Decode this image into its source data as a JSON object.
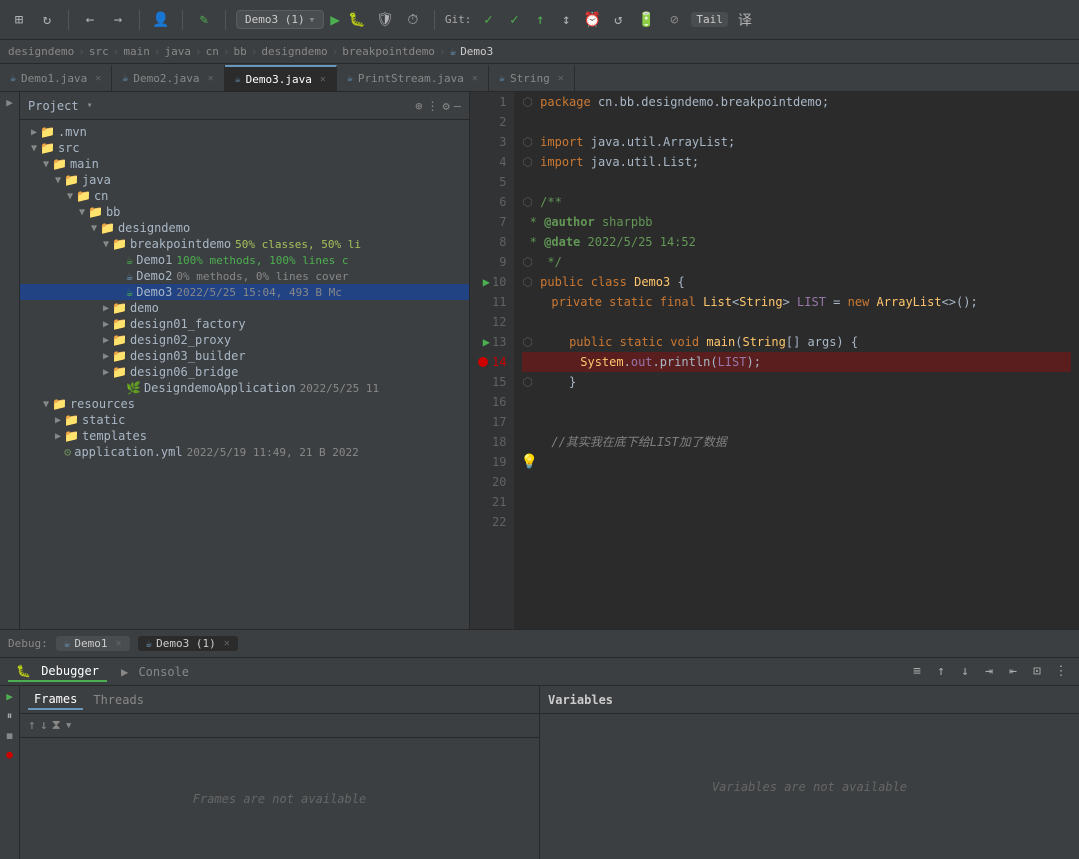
{
  "toolbar": {
    "run_config": "Demo3 (1)",
    "git_label": "Git:",
    "tail_label": "Tail"
  },
  "breadcrumb": {
    "parts": [
      "designdemo",
      "src",
      "main",
      "java",
      "cn",
      "bb",
      "designdemo",
      "breakpointdemo",
      "Demo3"
    ]
  },
  "editor_tabs": [
    {
      "label": "Demo1.java",
      "active": false,
      "icon": "☕"
    },
    {
      "label": "Demo2.java",
      "active": false,
      "icon": "☕"
    },
    {
      "label": "Demo3.java",
      "active": true,
      "icon": "☕"
    },
    {
      "label": "PrintStream.java",
      "active": false,
      "icon": "☕"
    },
    {
      "label": "String",
      "active": false,
      "icon": "☕"
    }
  ],
  "project": {
    "title": "Project",
    "tree": [
      {
        "indent": 0,
        "type": "folder",
        "open": true,
        "label": ".mvn",
        "meta": ""
      },
      {
        "indent": 0,
        "type": "folder",
        "open": true,
        "label": "src",
        "meta": ""
      },
      {
        "indent": 1,
        "type": "folder",
        "open": true,
        "label": "main",
        "meta": ""
      },
      {
        "indent": 2,
        "type": "folder",
        "open": true,
        "label": "java",
        "meta": ""
      },
      {
        "indent": 3,
        "type": "folder",
        "open": true,
        "label": "cn",
        "meta": ""
      },
      {
        "indent": 4,
        "type": "folder",
        "open": true,
        "label": "bb",
        "meta": ""
      },
      {
        "indent": 5,
        "type": "folder",
        "open": true,
        "label": "designdemo",
        "meta": ""
      },
      {
        "indent": 6,
        "type": "folder",
        "open": true,
        "label": "breakpointdemo",
        "meta": "50% classes, 50% li"
      },
      {
        "indent": 7,
        "type": "file-java-green",
        "label": "Demo1",
        "meta": "100% methods, 100% lines c"
      },
      {
        "indent": 7,
        "type": "file-java",
        "label": "Demo2",
        "meta": "0% methods, 0% lines cover"
      },
      {
        "indent": 7,
        "type": "file-java-active",
        "label": "Demo3",
        "meta": "2022/5/25 15:04, 493 B Mc",
        "selected": true
      },
      {
        "indent": 6,
        "type": "folder",
        "open": false,
        "label": "demo",
        "meta": ""
      },
      {
        "indent": 6,
        "type": "folder",
        "open": false,
        "label": "design01_factory",
        "meta": ""
      },
      {
        "indent": 6,
        "type": "folder",
        "open": false,
        "label": "design02_proxy",
        "meta": ""
      },
      {
        "indent": 6,
        "type": "folder",
        "open": false,
        "label": "design03_builder",
        "meta": ""
      },
      {
        "indent": 6,
        "type": "folder",
        "open": false,
        "label": "design06_bridge",
        "meta": ""
      },
      {
        "indent": 6,
        "type": "file-spring",
        "label": "DesigndemoApplication",
        "meta": "2022/5/25 11"
      },
      {
        "indent": 1,
        "type": "folder",
        "open": true,
        "label": "resources",
        "meta": ""
      },
      {
        "indent": 2,
        "type": "folder",
        "open": false,
        "label": "static",
        "meta": ""
      },
      {
        "indent": 2,
        "type": "folder",
        "open": false,
        "label": "templates",
        "meta": ""
      },
      {
        "indent": 2,
        "type": "file-yaml",
        "label": "application.yml",
        "meta": "2022/5/19 11:49, 21 B 2022"
      }
    ]
  },
  "code": {
    "lines": [
      {
        "num": 1,
        "content": "",
        "tokens": [
          {
            "text": "package ",
            "cls": "kw"
          },
          {
            "text": "cn.bb.designdemo.breakpointdemo;",
            "cls": "pkg"
          }
        ]
      },
      {
        "num": 2,
        "content": ""
      },
      {
        "num": 3,
        "content": "",
        "tokens": [
          {
            "text": "import ",
            "cls": "kw"
          },
          {
            "text": "java.util.ArrayList;",
            "cls": "pkg"
          }
        ]
      },
      {
        "num": 4,
        "content": "",
        "tokens": [
          {
            "text": "import ",
            "cls": "kw"
          },
          {
            "text": "java.util.List;",
            "cls": "pkg"
          }
        ]
      },
      {
        "num": 5,
        "content": ""
      },
      {
        "num": 6,
        "content": "",
        "tokens": [
          {
            "text": "/**",
            "cls": "javadoc"
          }
        ]
      },
      {
        "num": 7,
        "content": "",
        "tokens": [
          {
            "text": " * ",
            "cls": "javadoc"
          },
          {
            "text": "@author",
            "cls": "javadoc-tag"
          },
          {
            "text": " sharpbb",
            "cls": "javadoc"
          }
        ]
      },
      {
        "num": 8,
        "content": "",
        "tokens": [
          {
            "text": " * ",
            "cls": "javadoc"
          },
          {
            "text": "@date",
            "cls": "javadoc-tag"
          },
          {
            "text": " 2022/5/25 14:52",
            "cls": "javadoc"
          }
        ]
      },
      {
        "num": 9,
        "content": "",
        "tokens": [
          {
            "text": " */",
            "cls": "javadoc"
          }
        ]
      },
      {
        "num": 10,
        "content": "",
        "run_arrow": true,
        "tokens": [
          {
            "text": "public ",
            "cls": "kw"
          },
          {
            "text": "class ",
            "cls": "kw"
          },
          {
            "text": "Demo3",
            "cls": "class-name"
          },
          {
            "text": " {",
            "cls": "pkg"
          }
        ]
      },
      {
        "num": 11,
        "content": "",
        "tokens": [
          {
            "text": "    ",
            "cls": ""
          },
          {
            "text": "private ",
            "cls": "kw"
          },
          {
            "text": "static ",
            "cls": "kw"
          },
          {
            "text": "final ",
            "cls": "kw"
          },
          {
            "text": "List",
            "cls": "class-name"
          },
          {
            "text": "<",
            "cls": "pkg"
          },
          {
            "text": "String",
            "cls": "class-name"
          },
          {
            "text": "> ",
            "cls": "pkg"
          },
          {
            "text": "LIST",
            "cls": "var"
          },
          {
            "text": " = ",
            "cls": "pkg"
          },
          {
            "text": "new ",
            "cls": "kw"
          },
          {
            "text": "ArrayList",
            "cls": "class-name"
          },
          {
            "text": "<>()",
            "cls": "pkg"
          },
          {
            "text": ";",
            "cls": "pkg"
          }
        ]
      },
      {
        "num": 12,
        "content": ""
      },
      {
        "num": 13,
        "content": "",
        "run_arrow": true,
        "tokens": [
          {
            "text": "    ",
            "cls": ""
          },
          {
            "text": "public ",
            "cls": "kw"
          },
          {
            "text": "static ",
            "cls": "kw"
          },
          {
            "text": "void ",
            "cls": "kw"
          },
          {
            "text": "main",
            "cls": "method"
          },
          {
            "text": "(",
            "cls": "pkg"
          },
          {
            "text": "String",
            "cls": "class-name"
          },
          {
            "text": "[] args) {",
            "cls": "pkg"
          }
        ]
      },
      {
        "num": 14,
        "content": "",
        "breakpoint": true,
        "highlighted": true,
        "tokens": [
          {
            "text": "        ",
            "cls": ""
          },
          {
            "text": "System",
            "cls": "class-name"
          },
          {
            "text": ".",
            "cls": "pkg"
          },
          {
            "text": "out",
            "cls": "var"
          },
          {
            "text": ".println(",
            "cls": "pkg"
          },
          {
            "text": "LIST",
            "cls": "var"
          },
          {
            "text": ");",
            "cls": "pkg"
          }
        ]
      },
      {
        "num": 15,
        "content": "",
        "tokens": [
          {
            "text": "    }",
            "cls": "pkg"
          }
        ]
      },
      {
        "num": 16,
        "content": ""
      },
      {
        "num": 17,
        "content": ""
      },
      {
        "num": 18,
        "content": "",
        "tokens": [
          {
            "text": "    //其实我在底下给LIST加了数据",
            "cls": "comment"
          }
        ]
      },
      {
        "num": 19,
        "content": "",
        "lightbulb": true
      },
      {
        "num": 20,
        "content": ""
      },
      {
        "num": 21,
        "content": ""
      },
      {
        "num": 22,
        "content": ""
      }
    ]
  },
  "debug": {
    "label": "Debug:",
    "sessions": [
      {
        "label": "Demo1",
        "active": false
      },
      {
        "label": "Demo3 (1)",
        "active": true
      }
    ],
    "tabs": [
      {
        "label": "Debugger",
        "active": true,
        "icon": "🐛"
      },
      {
        "label": "Console",
        "active": false,
        "icon": "▶"
      }
    ],
    "frames_tab": "Frames",
    "threads_tab": "Threads",
    "frames_empty": "Frames are not available",
    "variables_header": "Variables",
    "variables_empty": "Variables are not available"
  }
}
